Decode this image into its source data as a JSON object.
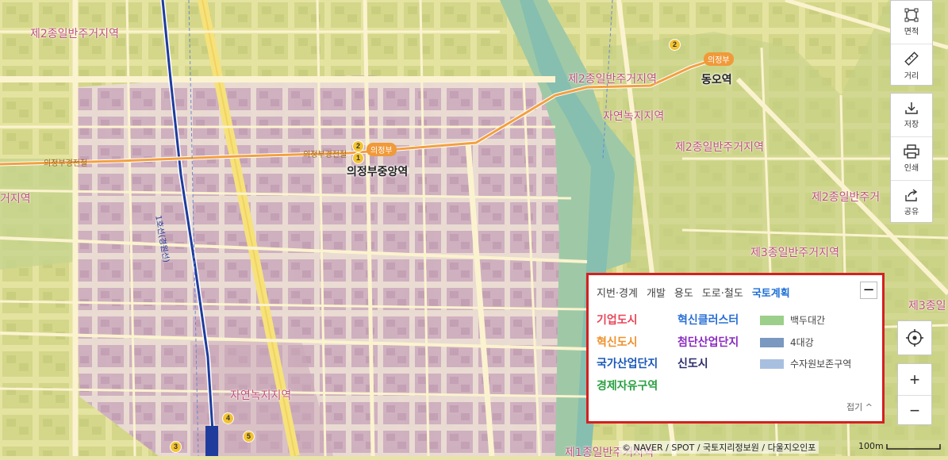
{
  "map": {
    "zone_labels": [
      "제2종일반주거지역",
      "제2종일반주거지역",
      "자연녹지지역",
      "제2종일반주거지역",
      "제2종일반주거",
      "거지역",
      "제3종일반주거지역",
      "제3종일",
      "자연녹지지역",
      "제1종일반주거지역"
    ],
    "stations": [
      "의정부중앙역",
      "동오역"
    ],
    "line_labels": [
      "의정부",
      "의정부"
    ],
    "line_texts": [
      "의정부경전철",
      "의정부경전철",
      "1호선(경원선)"
    ],
    "exit_numbers": [
      "2",
      "1",
      "2",
      "3",
      "4",
      "5"
    ]
  },
  "toolbar": {
    "area_label": "면적",
    "distance_label": "거리",
    "save_label": "저장",
    "print_label": "인쇄",
    "share_label": "공유",
    "zoom_in": "+",
    "zoom_out": "−"
  },
  "legend": {
    "tabs": [
      "지번·경계",
      "개발",
      "용도",
      "도로·철도",
      "국토계획"
    ],
    "active_tab": "국토계획",
    "minimize": "−",
    "categories": [
      {
        "label": "기업도시",
        "color": "#e8455a"
      },
      {
        "label": "혁신클러스터",
        "color": "#2a6fd6"
      },
      {
        "label": "혁신도시",
        "color": "#f0902a"
      },
      {
        "label": "첨단산업단지",
        "color": "#8a2ac0"
      },
      {
        "label": "국가산업단지",
        "color": "#1a58b8"
      },
      {
        "label": "신도시",
        "color": "#2a2a6a"
      },
      {
        "label": "경제자유구역",
        "color": "#2aa040"
      }
    ],
    "swatches": [
      {
        "label": "백두대간",
        "color": "#9ccf8a"
      },
      {
        "label": "4대강",
        "color": "#7a98c0"
      },
      {
        "label": "수자원보존구역",
        "color": "#a8c0e0"
      }
    ],
    "fold_label": "접기 ^"
  },
  "footer": {
    "attribution": "© NAVER / SPOT / 국토지리정보원 / 다울지오인포",
    "scale": "100m"
  }
}
